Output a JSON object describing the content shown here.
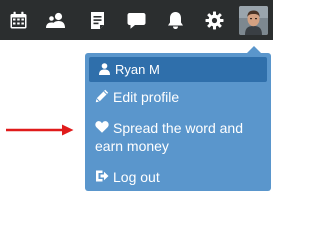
{
  "topbar": {
    "icons": [
      "calendar-icon",
      "users-icon",
      "document-icon",
      "chat-icon",
      "bell-icon",
      "gear-icon"
    ],
    "colors": {
      "background": "#2b2e2f",
      "icon": "#ffffff"
    }
  },
  "dropdown": {
    "user_name": "Ryan M",
    "items": [
      {
        "label": "Edit profile",
        "icon": "pencil-icon"
      },
      {
        "label": "Spread the word and earn money",
        "icon": "heart-icon"
      },
      {
        "label": "Log out",
        "icon": "logout-icon"
      }
    ],
    "colors": {
      "panel": "#5a96cc",
      "header": "#2f6fab",
      "text": "#ffffff"
    }
  },
  "annotation": {
    "arrow_color": "#e01b1b"
  }
}
